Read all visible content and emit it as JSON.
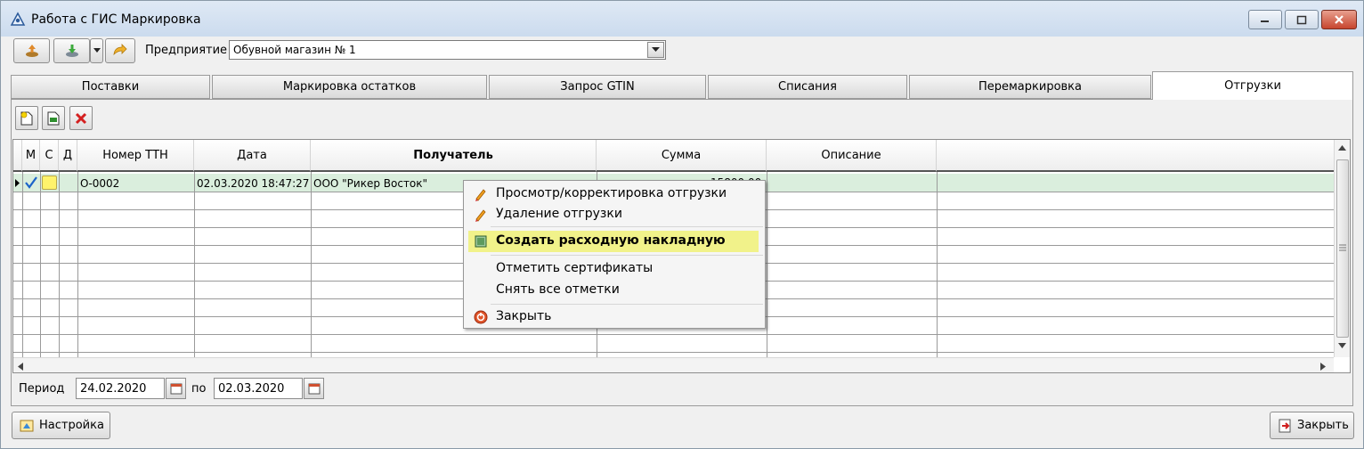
{
  "window": {
    "title": "Работа с ГИС Маркировка"
  },
  "toolbar": {
    "enterprise_label": "Предприятие",
    "enterprise_value": "Обувной магазин № 1"
  },
  "tabs": [
    {
      "label": "Поставки",
      "active": false
    },
    {
      "label": "Маркировка остатков",
      "active": false
    },
    {
      "label": "Запрос GTIN",
      "active": false
    },
    {
      "label": "Списания",
      "active": false
    },
    {
      "label": "Перемаркировка",
      "active": false
    },
    {
      "label": "Отгрузки",
      "active": true
    }
  ],
  "grid": {
    "columns": [
      "М",
      "С",
      "Д",
      "Номер ТТН",
      "Дата",
      "Получатель",
      "Сумма",
      "Описание"
    ],
    "rows": [
      {
        "m": "checked",
        "c": "yellow",
        "d": "",
        "number": "О-0002",
        "date": "02.03.2020 18:47:27",
        "recipient": "ООО \"Рикер Восток\"",
        "sum": "15800.00",
        "description": ""
      }
    ]
  },
  "context_menu": {
    "items": [
      {
        "label": "Просмотр/корректировка отгрузки",
        "icon": "pencil-icon"
      },
      {
        "label": "Удаление отгрузки",
        "icon": "pencil-icon"
      },
      {
        "label": "Создать расходную накладную",
        "icon": "document-icon",
        "highlighted": true
      },
      {
        "label": "Отметить сертификаты",
        "icon": ""
      },
      {
        "label": "Снять все отметки",
        "icon": ""
      },
      {
        "label": "Закрыть",
        "icon": "close-circle-icon"
      }
    ]
  },
  "period": {
    "label": "Период",
    "from": "24.02.2020",
    "to_label": "по",
    "to": "02.03.2020"
  },
  "footer": {
    "settings_label": "Настройка",
    "close_label": "Закрыть"
  },
  "colors": {
    "selected_row": "#daeedd",
    "menu_highlight": "#f1f28a",
    "check_mark": "#1a63c9",
    "status_yellow": "#fff36b"
  }
}
